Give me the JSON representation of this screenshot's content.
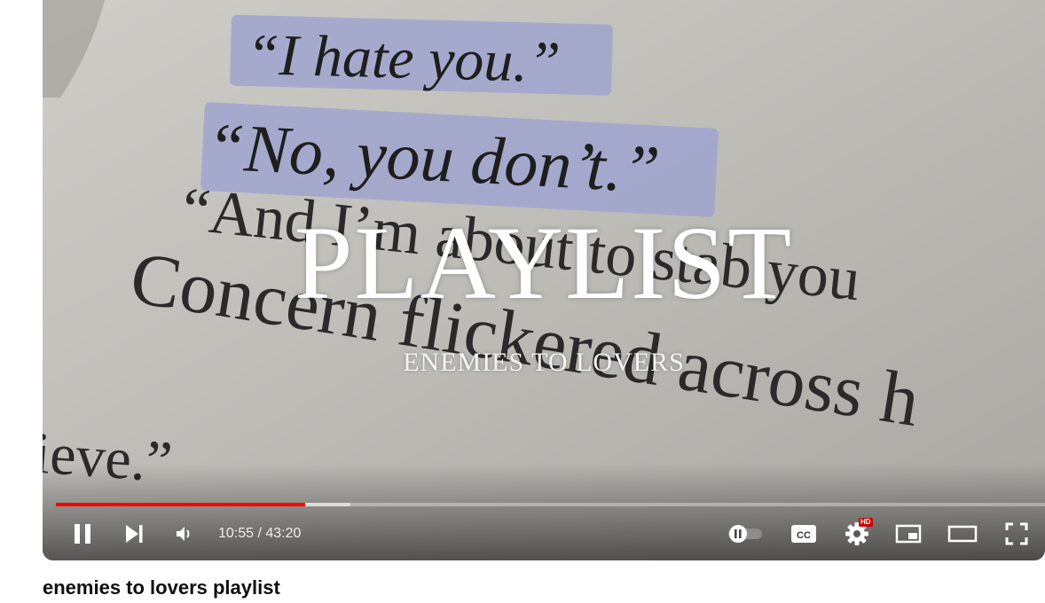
{
  "video": {
    "overlay_title": "PLAYLIST",
    "overlay_subtitle": "ENEMIES TO LOVERS",
    "page_text": {
      "line1": "“I hate you.”",
      "line2": "“No, you don’t.”",
      "line3": "“And I’m about to stab you",
      "line4": "Concern flickered across h",
      "line5": "ieve.”"
    }
  },
  "player": {
    "time_display": "10:55 / 43:20",
    "played_fraction": 0.252,
    "buffered_fraction": 0.298,
    "quality_badge": "HD",
    "accent_color": "#ff0000"
  },
  "title": "enemies to lovers playlist"
}
